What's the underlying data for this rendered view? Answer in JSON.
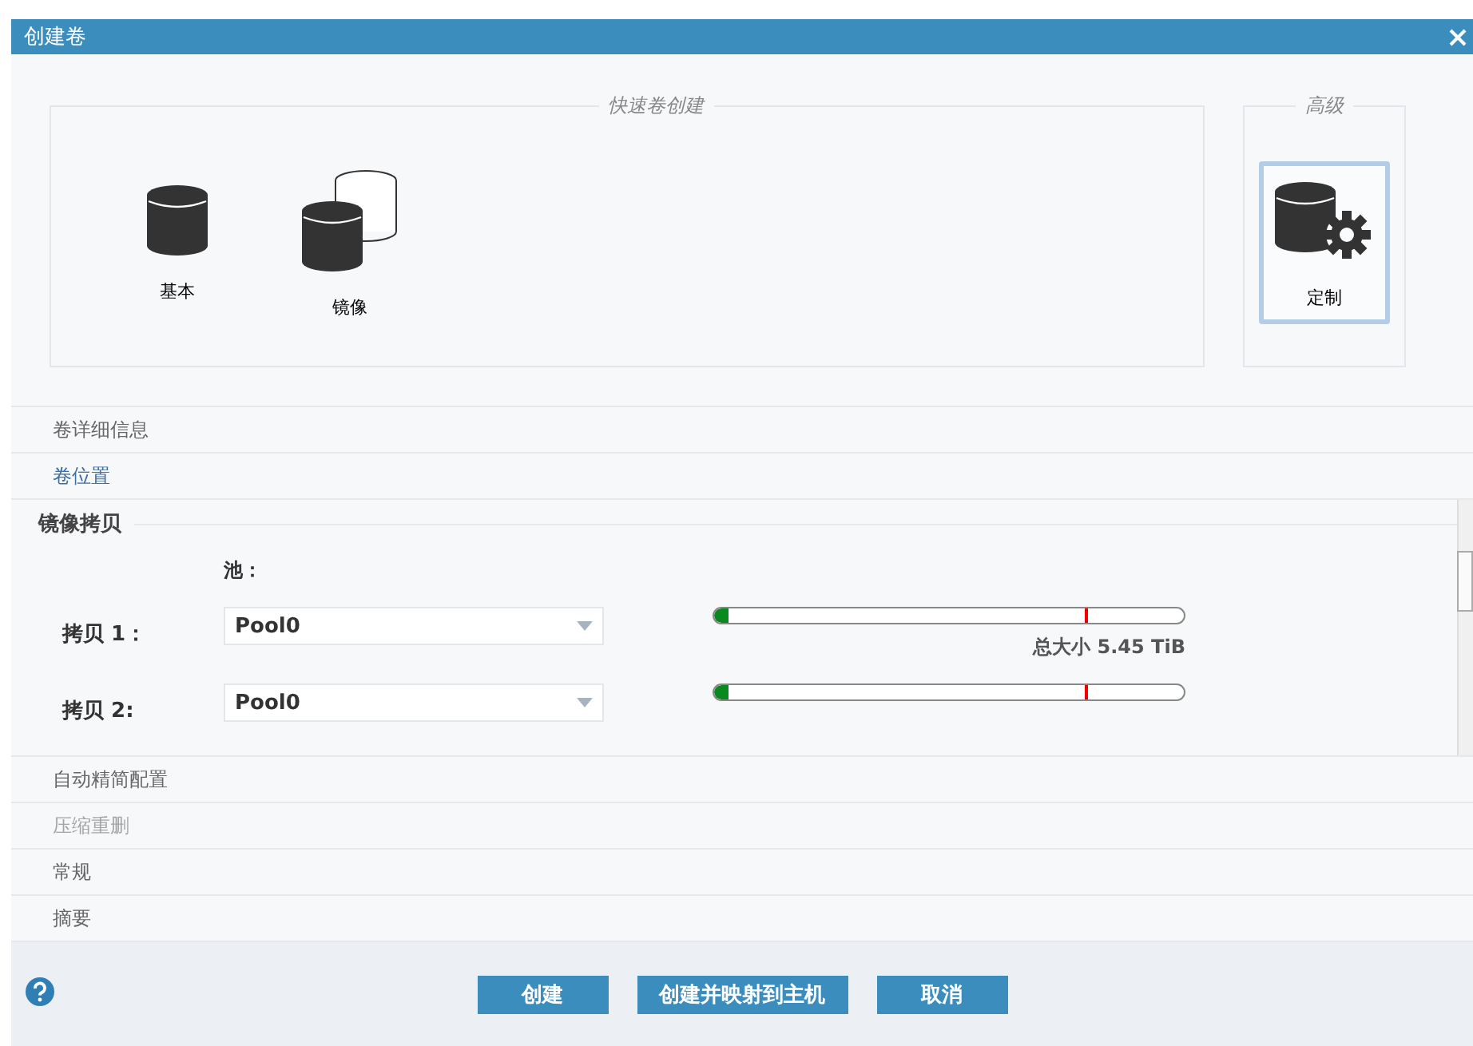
{
  "window": {
    "title": "创建卷"
  },
  "quick_create": {
    "legend": "快速卷创建",
    "options": [
      {
        "kind": "basic",
        "label": "基本",
        "selected": false
      },
      {
        "kind": "mirror",
        "label": "镜像",
        "selected": false
      }
    ]
  },
  "advanced": {
    "legend": "高级",
    "options": [
      {
        "kind": "custom",
        "label": "定制",
        "selected": true
      }
    ]
  },
  "steps_before": [
    {
      "label": "卷详细信息",
      "selected": false,
      "disabled": false
    },
    {
      "label": "卷位置",
      "selected": true,
      "disabled": false
    }
  ],
  "section": {
    "title": "镜像拷贝",
    "pool_header": "池：",
    "copies": [
      {
        "label": "拷贝 1：",
        "pool": "Pool0",
        "usage": {
          "level": 0.03
        },
        "threshold": {
          "level": 0.79
        },
        "caption": "总大小 5.45 TiB"
      },
      {
        "label": "拷贝 2:",
        "pool": "Pool0",
        "usage": {
          "level": 0.03
        },
        "threshold": {
          "level": 0.79
        }
      }
    ]
  },
  "steps_after": [
    {
      "label": "自动精简配置",
      "selected": false,
      "disabled": false
    },
    {
      "label": "压缩重删",
      "selected": false,
      "disabled": true
    },
    {
      "label": "常规",
      "selected": false,
      "disabled": false
    },
    {
      "label": "摘要",
      "selected": false,
      "disabled": false
    }
  ],
  "buttons": [
    "创建",
    "创建并映射到主机",
    "取消"
  ]
}
